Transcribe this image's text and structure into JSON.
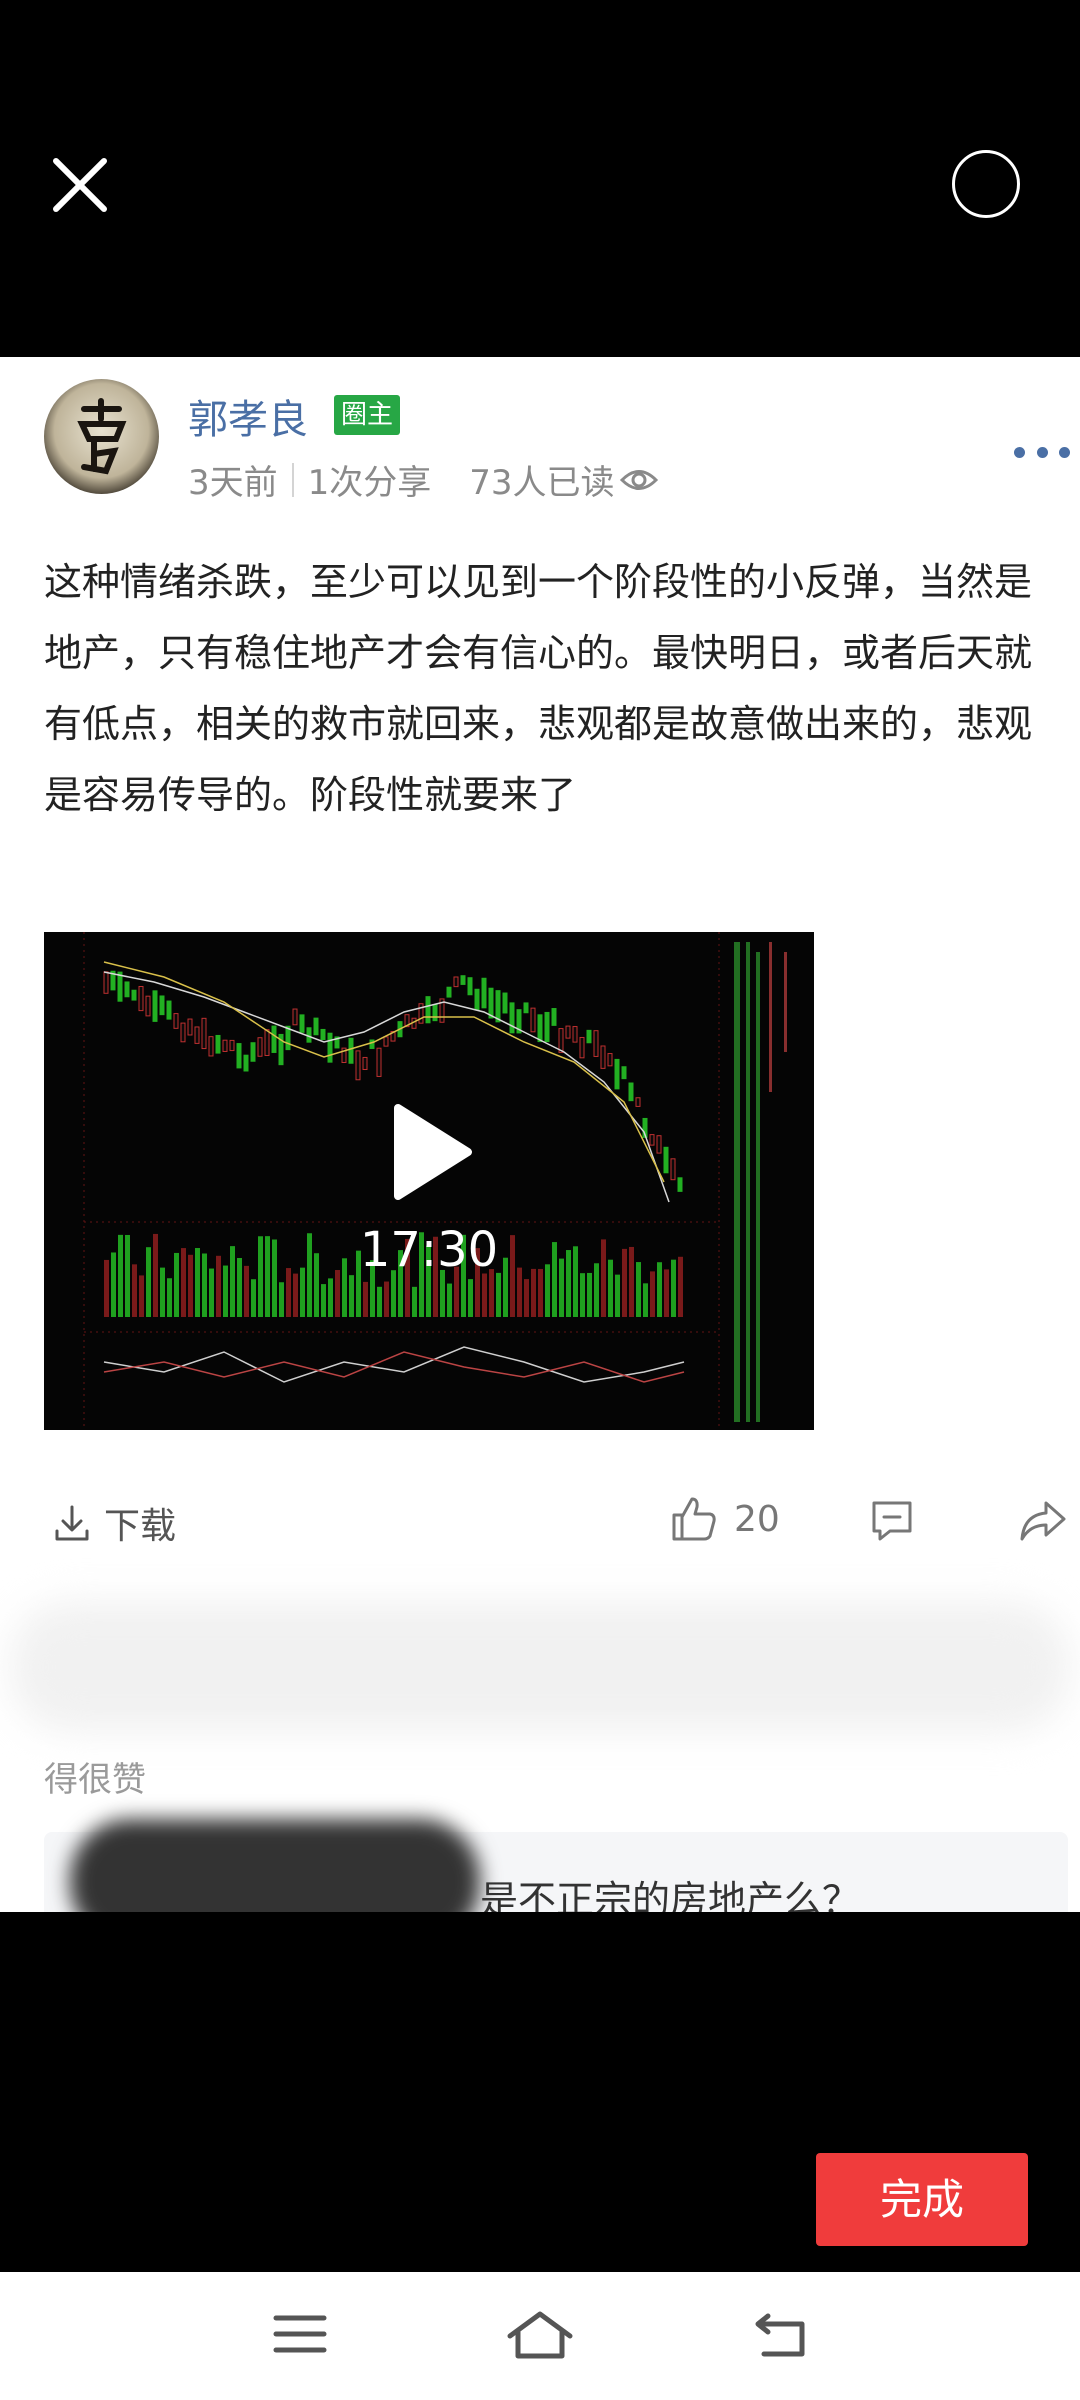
{
  "post": {
    "author_name": "郭孝良",
    "role_badge": "圈主",
    "time": "3天前",
    "shares": "1次分享",
    "reads": "73人已读",
    "body": "这种情绪杀跌，至少可以见到一个阶段性的小反弹，当然是地产，只有稳住地产才会有信心的。最快明日，或者后天就有低点，相关的救市就回来，悲观都是故意做出来的，悲观是容易传导的。阶段性就要来了",
    "video_duration": "17:30"
  },
  "actions": {
    "download_label": "下载",
    "like_count": "20"
  },
  "comment": {
    "text_tail": "得很赞",
    "quote_text": "是不正宗的房地产么？"
  },
  "footer": {
    "done_label": "完成"
  },
  "colors": {
    "author": "#4a6fa5",
    "badge": "#27a745",
    "done_button": "#f03c3c"
  },
  "icons": [
    "close-icon",
    "circle-icon",
    "more-icon",
    "eye-icon",
    "play-icon",
    "download-icon",
    "thumbs-up-icon",
    "comment-icon",
    "share-icon",
    "menu-icon",
    "home-icon",
    "back-icon"
  ]
}
